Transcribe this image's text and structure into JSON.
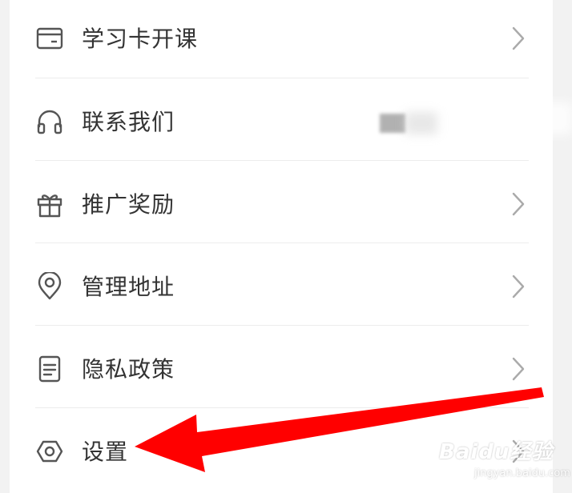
{
  "menu": {
    "items": [
      {
        "label": "学习卡开课",
        "icon": "card-icon",
        "has_chevron": true
      },
      {
        "label": "联系我们",
        "icon": "headset-icon",
        "has_chevron": false
      },
      {
        "label": "推广奖励",
        "icon": "gift-icon",
        "has_chevron": true
      },
      {
        "label": "管理地址",
        "icon": "location-pin-icon",
        "has_chevron": true
      },
      {
        "label": "隐私政策",
        "icon": "document-icon",
        "has_chevron": true
      },
      {
        "label": "设置",
        "icon": "settings-hexagon-icon",
        "has_chevron": true
      }
    ]
  },
  "annotation": {
    "arrow_color": "#ff0000"
  },
  "watermark": {
    "brand": "Baidu经验",
    "url": "jingyan.baidu.com"
  },
  "colors": {
    "text": "#333333",
    "icon": "#555555",
    "chevron": "#aaaaaa",
    "divider": "#ececec",
    "page_bg": "#f2f2f2",
    "card_bg": "#ffffff"
  }
}
